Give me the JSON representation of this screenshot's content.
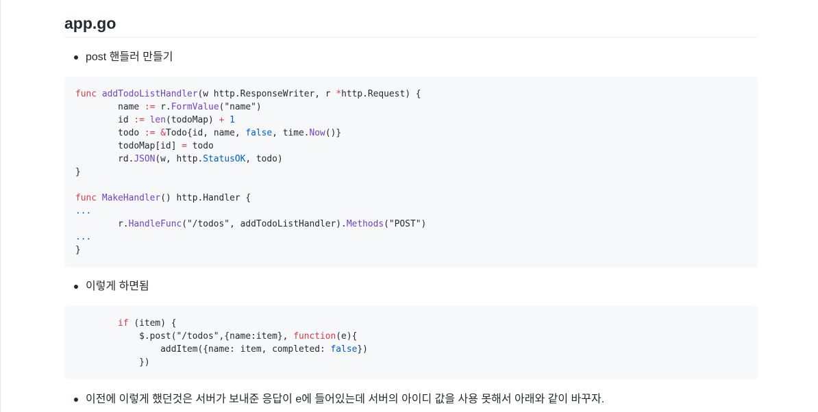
{
  "heading": "app.go",
  "bullets": [
    "post 핸들러 만들기",
    "이렇게 하면됨",
    "이전에 이렇게 했던것은 서버가 보내준 응답이 e에 들어있는데 서버의 아이디 값을 사용 못해서 아래와 같이 바꾸자."
  ],
  "code_blocks": [
    {
      "language": "go",
      "lines": [
        [
          {
            "t": "func",
            "c": "kw"
          },
          {
            "t": " "
          },
          {
            "t": "addTodoListHandler",
            "c": "fn"
          },
          {
            "t": "(w http.ResponseWriter, r "
          },
          {
            "t": "*",
            "c": "kw"
          },
          {
            "t": "http.Request) {"
          }
        ],
        [
          {
            "t": "        name "
          },
          {
            "t": ":=",
            "c": "kw"
          },
          {
            "t": " r."
          },
          {
            "t": "FormValue",
            "c": "fn"
          },
          {
            "t": "(\"name\")"
          }
        ],
        [
          {
            "t": "        id "
          },
          {
            "t": ":=",
            "c": "kw"
          },
          {
            "t": " "
          },
          {
            "t": "len",
            "c": "fn"
          },
          {
            "t": "(todoMap) "
          },
          {
            "t": "+",
            "c": "kw"
          },
          {
            "t": " "
          },
          {
            "t": "1",
            "c": "cn"
          }
        ],
        [
          {
            "t": "        todo "
          },
          {
            "t": ":=",
            "c": "kw"
          },
          {
            "t": " "
          },
          {
            "t": "&",
            "c": "kw"
          },
          {
            "t": "Todo{id, name, "
          },
          {
            "t": "false",
            "c": "cn"
          },
          {
            "t": ", time."
          },
          {
            "t": "Now",
            "c": "fn"
          },
          {
            "t": "()}"
          }
        ],
        [
          {
            "t": "        todoMap[id] "
          },
          {
            "t": "=",
            "c": "kw"
          },
          {
            "t": " todo"
          }
        ],
        [
          {
            "t": "        rd."
          },
          {
            "t": "JSON",
            "c": "fn"
          },
          {
            "t": "(w, http."
          },
          {
            "t": "StatusOK",
            "c": "cn"
          },
          {
            "t": ", todo)"
          }
        ],
        [
          {
            "t": "}"
          }
        ],
        [
          {
            "t": ""
          }
        ],
        [
          {
            "t": "func",
            "c": "kw"
          },
          {
            "t": " "
          },
          {
            "t": "MakeHandler",
            "c": "fn"
          },
          {
            "t": "() http.Handler {"
          }
        ],
        [
          {
            "t": "...",
            "c": "cn"
          }
        ],
        [
          {
            "t": "        r."
          },
          {
            "t": "HandleFunc",
            "c": "fn"
          },
          {
            "t": "(\"/todos\", addTodoListHandler)."
          },
          {
            "t": "Methods",
            "c": "fn"
          },
          {
            "t": "(\"POST\")"
          }
        ],
        [
          {
            "t": "...",
            "c": "cn"
          }
        ],
        [
          {
            "t": "}"
          }
        ]
      ]
    },
    {
      "language": "javascript",
      "lines": [
        [
          {
            "t": "        "
          },
          {
            "t": "if",
            "c": "kw"
          },
          {
            "t": " (item) {"
          }
        ],
        [
          {
            "t": "            $.post(\"/todos\",{name:item}, "
          },
          {
            "t": "function",
            "c": "kw"
          },
          {
            "t": "(e){"
          }
        ],
        [
          {
            "t": "                addItem({name: item, completed: "
          },
          {
            "t": "false",
            "c": "cn"
          },
          {
            "t": "})"
          }
        ],
        [
          {
            "t": "            })"
          }
        ]
      ]
    }
  ],
  "colors": {
    "keyword": "#d73a49",
    "function": "#6f42c1",
    "constant": "#005cc5",
    "code_background": "#f6f8fa",
    "text": "#24292e"
  }
}
